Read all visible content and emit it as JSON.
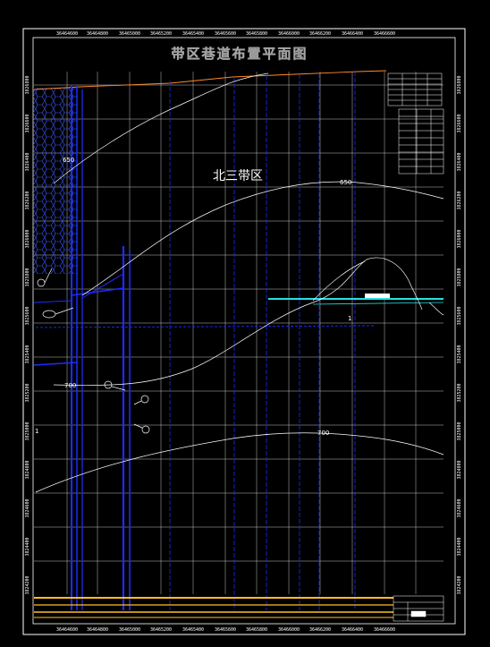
{
  "title": "带区巷道布置平面图",
  "area_label": "北三带区",
  "contour_labels": {
    "c650_left": "650",
    "c650_right": "650",
    "c700_left": "700",
    "c700_right": "700"
  },
  "misc_labels": {
    "one_a": "1",
    "one_b": "1"
  },
  "top_coords": [
    "36464600",
    "36464800",
    "36465000",
    "36465200",
    "36465400",
    "36465600",
    "36465800",
    "36466000",
    "36466200",
    "36466400",
    "36466600"
  ],
  "bottom_coords": [
    "36464600",
    "36464800",
    "36465000",
    "36465200",
    "36465400",
    "36465600",
    "36465800",
    "36466000",
    "36466200",
    "36466400",
    "36466600"
  ],
  "side_coords": [
    "3826800",
    "3826600",
    "3826400",
    "3826200",
    "3826000",
    "3825800",
    "3825600",
    "3825400",
    "3825200",
    "3825000",
    "3824800",
    "3824600",
    "3824400",
    "3824200"
  ],
  "colors": {
    "background": "#000000",
    "frame": "#ffffff",
    "grid": "#ffffff",
    "roadway": "#1e2bff",
    "contour": "#ffffff",
    "boundary": "#ff8c2a",
    "bottom_roadway": "#ffc020",
    "cyan": "#29e0e0"
  }
}
